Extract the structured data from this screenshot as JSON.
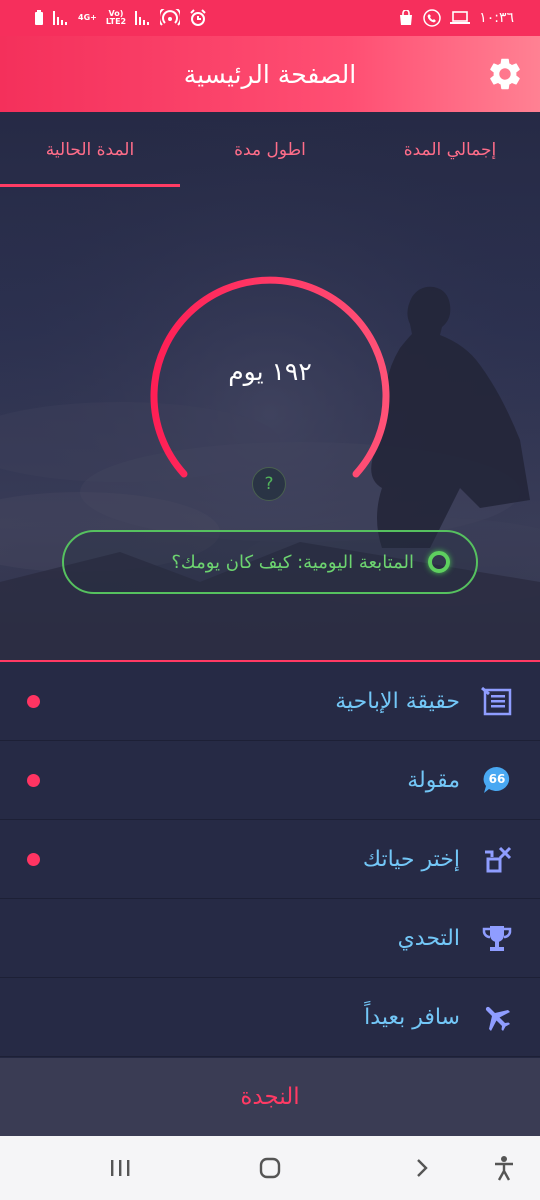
{
  "status_bar": {
    "time": "١٠:٣٦",
    "network_top": "4G+",
    "volte_top": "Vo)",
    "volte_bottom": "LTE2"
  },
  "app_bar": {
    "title": "الصفحة الرئيسية",
    "settings_icon": "gear-icon"
  },
  "tabs": [
    {
      "label": "إجمالي المدة",
      "active": false
    },
    {
      "label": "اطول مدة",
      "active": false
    },
    {
      "label": "المدة الحالية",
      "active": true
    }
  ],
  "gauge": {
    "value_text": "١٩٢ يوم",
    "help_label": "?"
  },
  "daily_checkin": {
    "label": "المتابعة اليومية: كيف كان يومك؟"
  },
  "menu": [
    {
      "label": "حقيقة الإباحية",
      "icon": "article-icon",
      "badge": true
    },
    {
      "label": "مقولة",
      "icon": "quote-bubble-icon",
      "badge": true
    },
    {
      "label": "إختر حياتك",
      "icon": "choose-life-icon",
      "badge": true
    },
    {
      "label": "التحدي",
      "icon": "trophy-icon",
      "badge": false
    },
    {
      "label": "سافر بعيداً",
      "icon": "airplane-icon",
      "badge": false
    }
  ],
  "rescue": {
    "label": "النجدة"
  },
  "colors": {
    "accent": "#ff3a64",
    "menu_text": "#73c7f7",
    "checkin_green": "#56c15f",
    "icon_blue": "#8f9dff"
  }
}
